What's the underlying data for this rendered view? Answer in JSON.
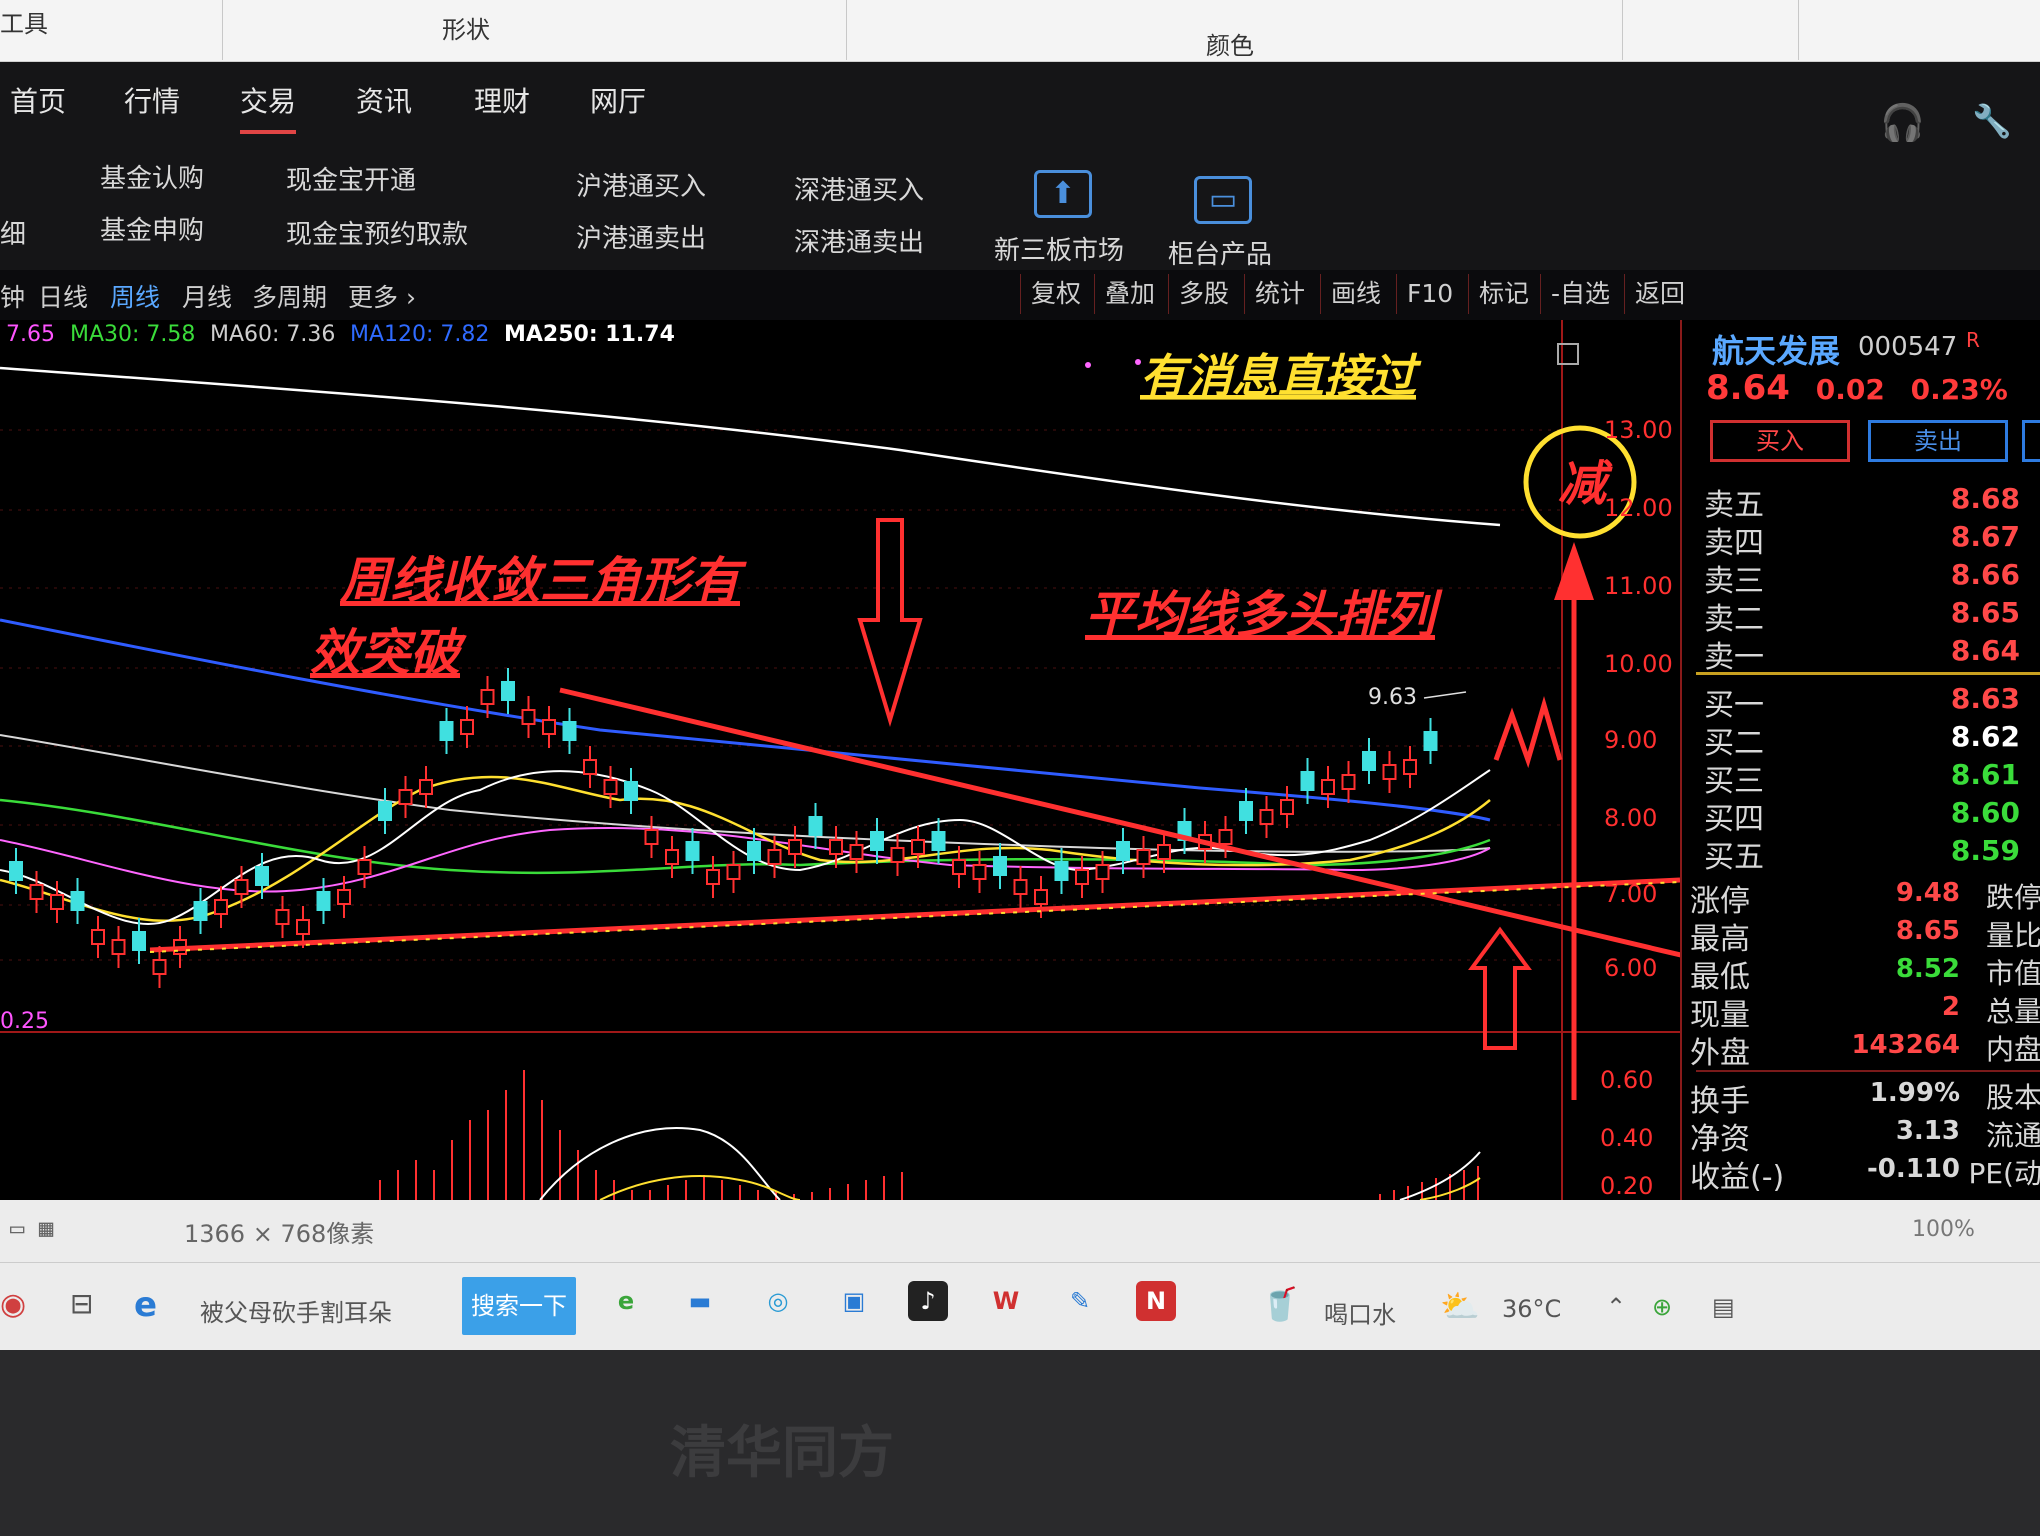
{
  "ribbon": {
    "left": "工具",
    "shape": "形状",
    "color": "颜色"
  },
  "nav": {
    "tabs": [
      "首页",
      "行情",
      "交易",
      "资讯",
      "理财",
      "网厅"
    ]
  },
  "submenu": {
    "col0": [
      "细"
    ],
    "col1": [
      "基金认购",
      "基金申购"
    ],
    "col2": [
      "现金宝开通",
      "现金宝预约取款"
    ],
    "col3": [
      "沪港通买入",
      "沪港通卖出"
    ],
    "col4": [
      "深港通买入",
      "深港通卖出"
    ],
    "xinsanban": "新三板市场",
    "guitai": "柜台产品"
  },
  "periods": [
    "钟",
    "日线",
    "周线",
    "月线",
    "多周期",
    "更多 ›"
  ],
  "tools": [
    "复权",
    "叠加",
    "多股",
    "统计",
    "画线",
    "F10",
    "标记",
    "-自选",
    "返回"
  ],
  "ma_legend": [
    {
      "label": "7.65",
      "color": "#ff55ff"
    },
    {
      "label": "MA30: 7.58",
      "color": "#3adc3a"
    },
    {
      "label": "MA60: 7.36",
      "color": "#cfcfcf"
    },
    {
      "label": "MA120: 7.82",
      "color": "#2f6bff"
    },
    {
      "label": "MA250: 11.74",
      "color": "#ffffff"
    }
  ],
  "annotations": {
    "news": "有消息直接过",
    "triangle_line1": "周线收敛三角形有",
    "triangle_line2": "效突破",
    "ma_bull": "平均线多头排列",
    "circle": "减",
    "peak_label": "9.63"
  },
  "price_axis": [
    "13.00",
    "12.00",
    "11.00",
    "10.00",
    "9.00",
    "8.00",
    "7.00",
    "6.00"
  ],
  "sub_axis": [
    "0.60",
    "0.40",
    "0.20"
  ],
  "sub_indicator": "0.25",
  "quote": {
    "name": "航天发展",
    "code": "000547",
    "flag": "R",
    "price": "8.64",
    "change": "0.02",
    "pct": "0.23%",
    "buy": "买入",
    "sell": "卖出",
    "asks": [
      {
        "label": "卖五",
        "price": "8.68"
      },
      {
        "label": "卖四",
        "price": "8.67"
      },
      {
        "label": "卖三",
        "price": "8.66"
      },
      {
        "label": "卖二",
        "price": "8.65"
      },
      {
        "label": "卖一",
        "price": "8.64"
      }
    ],
    "bids": [
      {
        "label": "买一",
        "price": "8.63",
        "color": "#ff4848"
      },
      {
        "label": "买二",
        "price": "8.62",
        "color": "#ffffff"
      },
      {
        "label": "买三",
        "price": "8.61",
        "color": "#3adc3a"
      },
      {
        "label": "买四",
        "price": "8.60",
        "color": "#3adc3a"
      },
      {
        "label": "买五",
        "price": "8.59",
        "color": "#3adc3a"
      }
    ],
    "fields": [
      {
        "label": "涨停",
        "value": "9.48",
        "extra": "跌停",
        "color": "#ff4848"
      },
      {
        "label": "最高",
        "value": "8.65",
        "extra": "量比",
        "color": "#ff4848"
      },
      {
        "label": "最低",
        "value": "8.52",
        "extra": "市值",
        "color": "#3adc3a"
      },
      {
        "label": "现量",
        "value": "2",
        "extra": "总量",
        "color": "#ff4848"
      },
      {
        "label": "外盘",
        "value": "143264",
        "extra": "内盘",
        "color": "#ff4848"
      },
      {
        "label": "换手",
        "value": "1.99%",
        "extra": "股本",
        "color": "#d8d8d8"
      },
      {
        "label": "净资",
        "value": "3.13",
        "extra": "流通",
        "color": "#d8d8d8"
      },
      {
        "label": "收益(-)",
        "value": "-0.110",
        "extra": "PE(动",
        "color": "#d8d8d8"
      }
    ]
  },
  "statusbar": {
    "resolution": "1366 × 768像素",
    "zoom": "100%"
  },
  "taskbar": {
    "tab_title": "被父母砍手割耳朵",
    "search": "搜索一下",
    "drink": "喝口水",
    "weather": "36°C"
  },
  "brand": "清华同方",
  "chart_data": {
    "type": "candlestick",
    "period": "weekly",
    "ylim": [
      5.5,
      13.2
    ],
    "peak": 9.63,
    "ma_values": {
      "MA30": 7.58,
      "MA60": 7.36,
      "MA120": 7.82,
      "MA250": 11.74
    },
    "last_price": 8.64
  }
}
